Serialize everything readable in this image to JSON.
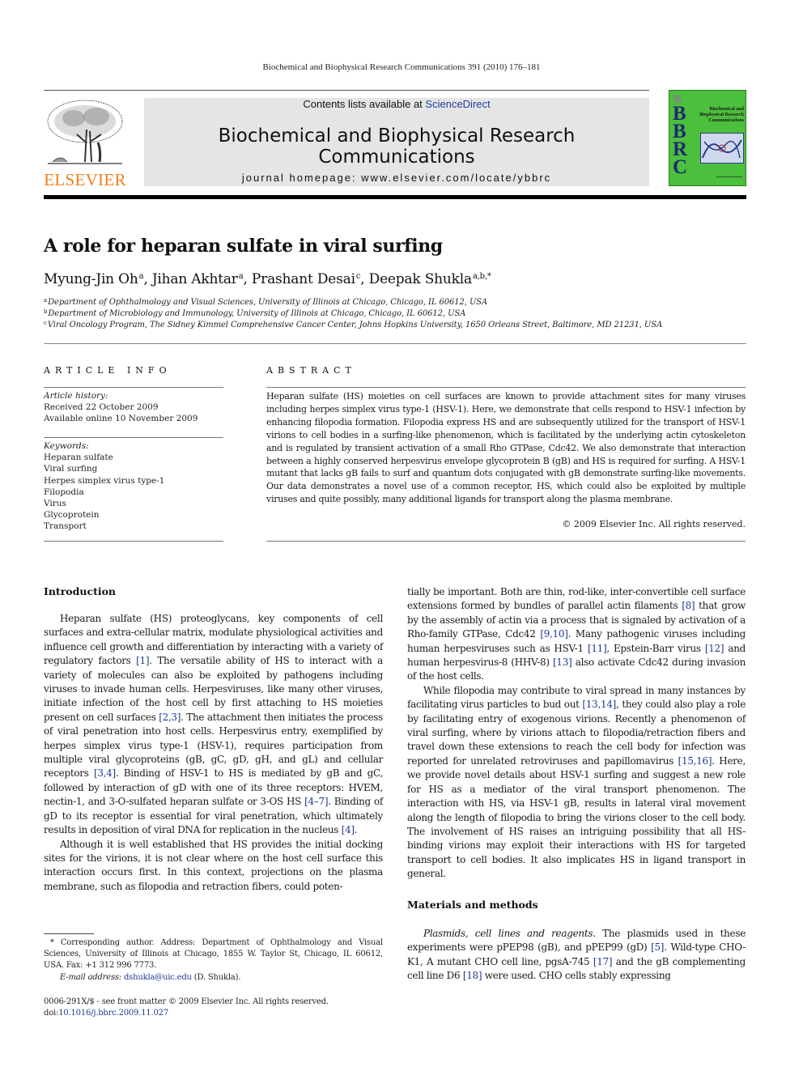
{
  "running_head": "Biochemical and Biophysical Research Communications 391 (2010) 176–181",
  "masthead": {
    "contents_prefix": "Contents lists available at",
    "contents_link": "ScienceDirect",
    "journal_title": "Biochemical and Biophysical Research Communications",
    "homepage": "journal homepage: www.elsevier.com/locate/ybbrc",
    "publisher_logo_text": "ELSEVIER",
    "cover": {
      "letters": [
        "B",
        "B",
        "R",
        "C"
      ],
      "title": "Biochemical and Biophysical Research Communications",
      "bg_color": "#4cbf3c",
      "letter_color": "#1d2a6e"
    },
    "link_color": "#1f3fa0",
    "logo_color": "#f07f1a"
  },
  "article": {
    "title": "A role for heparan sulfate in viral surfing",
    "authors": [
      {
        "name": "Myung-Jin Oh",
        "sup": "a",
        "sep": ", "
      },
      {
        "name": "Jihan Akhtar",
        "sup": "a",
        "sep": ", "
      },
      {
        "name": "Prashant Desai",
        "sup": "c",
        "sep": ", "
      },
      {
        "name": "Deepak Shukla",
        "sup": "a,b,*",
        "sep": ""
      }
    ],
    "affiliations": [
      {
        "key": "a",
        "text": "Department of Ophthalmology and Visual Sciences, University of Illinois at Chicago, Chicago, IL 60612, USA"
      },
      {
        "key": "b",
        "text": "Department of Microbiology and Immunology, University of Illinois at Chicago, Chicago, IL 60612, USA"
      },
      {
        "key": "c",
        "text": "Viral Oncology Program, The Sidney Kimmel Comprehensive Cancer Center, Johns Hopkins University, 1650 Orleans Street, Baltimore, MD 21231, USA"
      }
    ]
  },
  "article_info": {
    "heading": "ARTICLE INFO",
    "history_label": "Article history:",
    "received": "Received 22 October 2009",
    "online": "Available online 10 November 2009",
    "keywords_label": "Keywords:",
    "keywords": [
      "Heparan sulfate",
      "Viral surfing",
      "Herpes simplex virus type-1",
      "Filopodia",
      "Virus",
      "Glycoprotein",
      "Transport"
    ]
  },
  "abstract": {
    "heading": "ABSTRACT",
    "text": "Heparan sulfate (HS) moieties on cell surfaces are known to provide attachment sites for many viruses including herpes simplex virus type-1 (HSV-1). Here, we demonstrate that cells respond to HSV-1 infection by enhancing filopodia formation. Filopodia express HS and are subsequently utilized for the transport of HSV-1 virions to cell bodies in a surfing-like phenomenon, which is facilitated by the underlying actin cytoskeleton and is regulated by transient activation of a small Rho GTPase, Cdc42. We also demonstrate that interaction between a highly conserved herpesvirus envelope glycoprotein B (gB) and HS is required for surfing. A HSV-1 mutant that lacks gB fails to surf and quantum dots conjugated with gB demonstrate surfing-like movements. Our data demonstrates a novel use of a common receptor, HS, which could also be exploited by multiple viruses and quite possibly, many additional ligands for transport along the plasma membrane.",
    "copyright": "© 2009 Elsevier Inc. All rights reserved."
  },
  "body": {
    "intro_heading": "Introduction",
    "intro_p1": [
      {
        "t": "Heparan sulfate (HS) proteoglycans, key components of cell surfaces and extra-cellular matrix, modulate physiological activities and influence cell growth and differentiation by interacting with a variety of regulatory factors "
      },
      {
        "r": "[1]"
      },
      {
        "t": ". The versatile ability of HS to interact with a variety of molecules can also be exploited by pathogens including viruses to invade human cells. Herpesviruses, like many other viruses, initiate infection of the host cell by first attaching to HS moieties present on cell surfaces "
      },
      {
        "r": "[2,3]"
      },
      {
        "t": ". The attachment then initiates the process of viral penetration into host cells. Herpesvirus entry, exemplified by herpes simplex virus type-1 (HSV-1), requires participation from multiple viral glycoproteins (gB, gC, gD, gH, and gL) and cellular receptors "
      },
      {
        "r": "[3,4]"
      },
      {
        "t": ". Binding of HSV-1 to HS is mediated by gB and gC, followed by interaction of gD with one of its three receptors: HVEM, nectin-1, and 3-O-sulfated heparan sulfate or 3-OS HS "
      },
      {
        "r": "[4–7]"
      },
      {
        "t": ". Binding of gD to its receptor is essential for viral penetration, which ultimately results in deposition of viral DNA for replication in the nucleus "
      },
      {
        "r": "[4]"
      },
      {
        "t": "."
      }
    ],
    "intro_p2_left": "Although it is well established that HS provides the initial docking sites for the virions, it is not clear where on the host cell surface this interaction occurs first. In this context, projections on the plasma membrane, such as filopodia and retraction fibers, could poten-",
    "intro_p2_right": [
      {
        "t": "tially be important. Both are thin, rod-like, inter-convertible cell surface extensions formed by bundles of parallel actin filaments "
      },
      {
        "r": "[8]"
      },
      {
        "t": " that grow by the assembly of actin via a process that is signaled by activation of a Rho-family GTPase, Cdc42 "
      },
      {
        "r": "[9,10]"
      },
      {
        "t": ". Many pathogenic viruses including human herpesviruses such as HSV-1 "
      },
      {
        "r": "[11]"
      },
      {
        "t": ", Epstein-Barr virus "
      },
      {
        "r": "[12]"
      },
      {
        "t": " and human herpesvirus-8 (HHV-8) "
      },
      {
        "r": "[13]"
      },
      {
        "t": " also activate Cdc42 during invasion of the host cells."
      }
    ],
    "intro_p3": [
      {
        "t": "While filopodia may contribute to viral spread in many instances by facilitating virus particles to bud out "
      },
      {
        "r": "[13,14]"
      },
      {
        "t": ", they could also play a role by facilitating entry of exogenous virions. Recently a phenomenon of viral surfing, where by virions attach to filopodia/retraction fibers and travel down these extensions to reach the cell body for infection was reported for unrelated retroviruses and papillomavirus "
      },
      {
        "r": "[15,16]"
      },
      {
        "t": ". Here, we provide novel details about HSV-1 surfing and suggest a new role for HS as a mediator of the viral transport phenomenon. The interaction with HS, via HSV-1 gB, results in lateral viral movement along the length of filopodia to bring the virions closer to the cell body. The involvement of HS raises an intriguing possibility that all HS-binding virions may exploit their interactions with HS for targeted transport to cell bodies. It also implicates HS in ligand transport in general."
      }
    ],
    "methods_heading": "Materials and methods",
    "methods_p1": [
      {
        "i": "Plasmids, cell lines and reagents"
      },
      {
        "t": ". The plasmids used in these experiments were pPEP98 (gB), and pPEP99 (gD) "
      },
      {
        "r": "[5]"
      },
      {
        "t": ". Wild-type CHO-K1, A mutant CHO cell line, pgsA-745 "
      },
      {
        "r": "[17]"
      },
      {
        "t": " and the gB complementing cell line D6 "
      },
      {
        "r": "[18]"
      },
      {
        "t": " were used. CHO cells stably expressing"
      }
    ]
  },
  "footnotes": {
    "corresponding": "* Corresponding author. Address: Department of Ophthalmology and Visual Sciences, University of Illinois at Chicago, 1855 W. Taylor St, Chicago, IL 60612, USA. Fax: +1 312 996 7773.",
    "email_label": "E-mail address:",
    "email": "dshukla@uic.edu",
    "email_suffix": " (D. Shukla).",
    "issn_line": "0006-291X/$ - see front matter © 2009 Elsevier Inc. All rights reserved.",
    "doi_prefix": "doi:",
    "doi": "10.1016/j.bbrc.2009.11.027"
  }
}
